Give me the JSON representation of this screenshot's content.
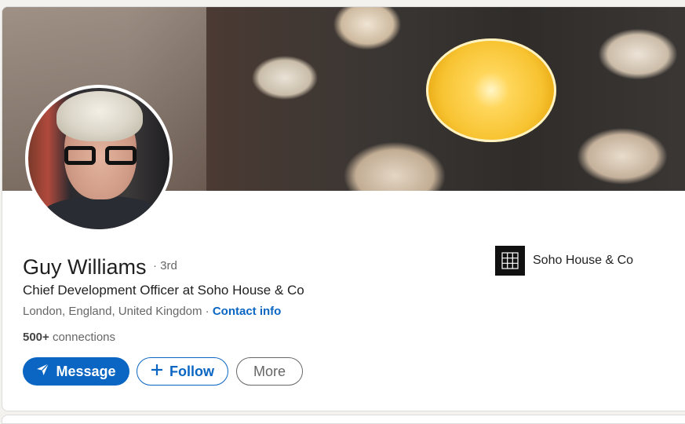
{
  "profile": {
    "name": "Guy Williams",
    "degree": "· 3rd",
    "headline": "Chief Development Officer at Soho House & Co",
    "location": "London, England, United Kingdom ·",
    "contact_label": "Contact info",
    "connections_count": "500+",
    "connections_label": "connections"
  },
  "actions": {
    "message_label": "Message",
    "follow_label": "Follow",
    "more_label": "More"
  },
  "company": {
    "name": "Soho House & Co"
  },
  "colors": {
    "accent": "#0a66c2",
    "text_primary": "#1f1f1f",
    "text_secondary": "#666666"
  },
  "icons": {
    "message": "paper-plane-icon",
    "follow": "plus-icon",
    "company_logo": "grid-logo-icon"
  }
}
